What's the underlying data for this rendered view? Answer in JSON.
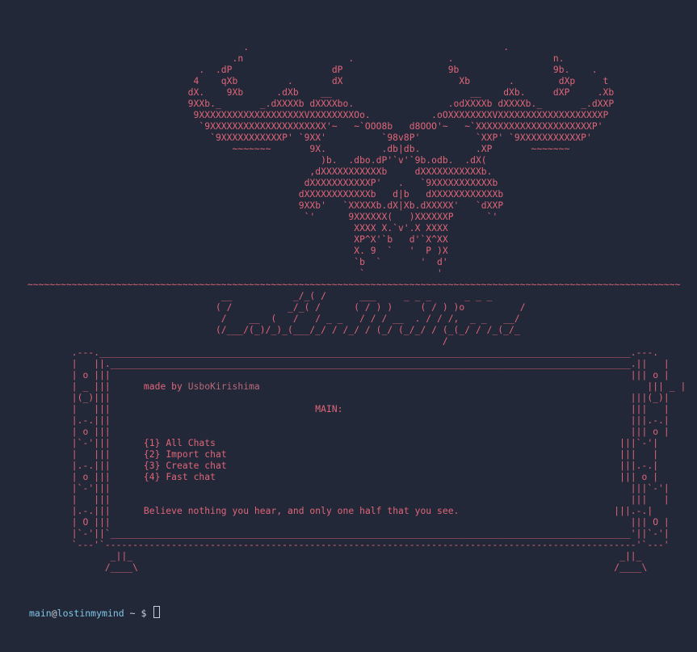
{
  "moose_art": [
    "                                       .                                              .",
    "                                     .n                   .                 .                  n.",
    "                               .  .dP                  dP                   9b                 9b.    .",
    "                              4    qXb         .       dX                     Xb       .        dXp     t",
    "                             dX.    9Xb      .dXb    __                         __    dXb.     dXP     .Xb",
    "                             9XXb._       _.dXXXXb dXXXXbo.                 .odXXXXb dXXXXb._       _.dXXP",
    "                              9XXXXXXXXXXXXXXXXXXXVXXXXXXXXOo.           .oOXXXXXXXXVXXXXXXXXXXXXXXXXXXXP",
    "                               `9XXXXXXXXXXXXXXXXXXXXX'~   ~`OOO8b   d8OOO'~   ~`XXXXXXXXXXXXXXXXXXXXXP'",
    "                                 `9XXXXXXXXXXXP' `9XX'          `98v8P'          `XXP' `9XXXXXXXXXXXP'",
    "                                     ~~~~~~~       9X.          .db|db.          .XP       ~~~~~~~",
    "                                                     )b.  .dbo.dP'`v'`9b.odb.  .dX(",
    "                                                   ,dXXXXXXXXXXXb     dXXXXXXXXXXXb.",
    "                                                  dXXXXXXXXXXXP'   .   `9XXXXXXXXXXXb",
    "                                                 dXXXXXXXXXXXXb   d|b   dXXXXXXXXXXXXb",
    "                                                 9XXb'   `XXXXXb.dX|Xb.dXXXXX'   `dXXP",
    "                                                  `'      9XXXXXX(   )XXXXXXP      `'",
    "                                                           XXXX X.`v'.X XXXX",
    "                                                           XP^X'`b   d'`X^XX",
    "                                                           X. 9  `   '  P )X",
    "                                                           `b  `       '  d'",
    "                                                            `             '"
  ],
  "divider": "~~~~~~~~~~~~~~~~~~~~~~~~~~~~~~~~~~~~~~~~~~~~~~~~~~~~~~~~~~~~~~~~~~~~~~~~~~~~~~~~~~~~~~~~~~~~~~~~~~~~~~~~~~~~~~~~~~~~~~",
  "logo_art": [
    "                                   __           _/_( /      ___     _ _ _      _ _ _",
    "                                  ( /          _/_( /      ( / ) )     ( / ) )o          /",
    "                                   /    __  (   /   / _ _   / / / __  . / / /,  _ _   __/",
    "                                  (/___/(_)/_)_(___/_/ / /_/ / (_/ (_/_/ / (_(_/ / /_(_/_",
    "                                                                           /"
  ],
  "menu": {
    "made_by_label": "made by",
    "author": "UsboKirishima",
    "section_title": "MAIN:",
    "items": [
      {
        "key": "{1}",
        "label": "All Chats"
      },
      {
        "key": "{2}",
        "label": "Import chat"
      },
      {
        "key": "{3}",
        "label": "Create chat"
      },
      {
        "key": "{4}",
        "label": "Fast chat"
      }
    ],
    "quote": "Believe nothing you hear, and only one half that you see."
  },
  "prompt": {
    "user": "main",
    "at": "@",
    "host": "lostinmymind",
    "path": " ~ ",
    "symbol": "$ "
  },
  "colors": {
    "background": "#222837",
    "art": "#e0667a",
    "prompt_user": "#7ec6e8"
  }
}
